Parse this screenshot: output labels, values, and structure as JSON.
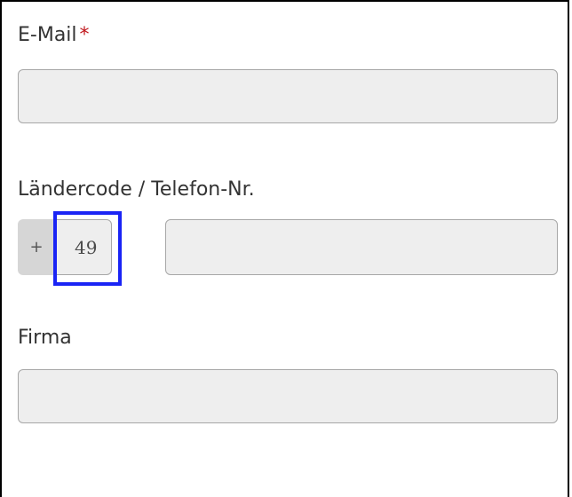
{
  "form": {
    "email": {
      "label": "E-Mail",
      "required_marker": "*",
      "value": ""
    },
    "phone": {
      "label": "Ländercode / Telefon-Nr.",
      "prefix_symbol": "+",
      "country_code_value": "49",
      "number_value": ""
    },
    "company": {
      "label": "Firma",
      "value": ""
    }
  },
  "colors": {
    "required_star": "#c0161b",
    "field_background": "#eeeeee",
    "field_border": "#a7a7a7",
    "addon_background": "#d6d6d6",
    "highlight_box": "#1a24f5"
  }
}
